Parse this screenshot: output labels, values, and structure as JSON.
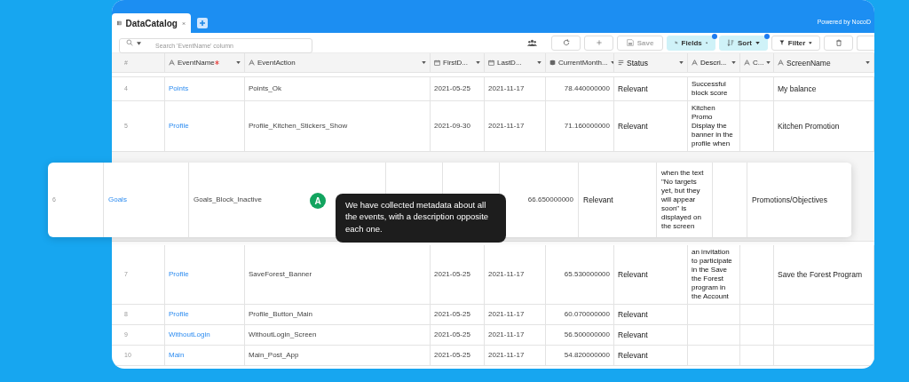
{
  "tab": {
    "title": "DataCatalog"
  },
  "powered_by": "Powered by NocoD",
  "search": {
    "placeholder": "Search 'EventName' column"
  },
  "toolbar": [
    {
      "kind": "reload"
    },
    {
      "kind": "add"
    },
    {
      "kind": "save",
      "label": "Save",
      "disabled": true
    },
    {
      "kind": "fields",
      "label": "Fields",
      "active": true
    },
    {
      "kind": "sort",
      "label": "Sort",
      "active": true
    },
    {
      "kind": "filter",
      "label": "Filter",
      "active": false
    },
    {
      "kind": "delete"
    }
  ],
  "columns": [
    {
      "name": "#",
      "kind": "index",
      "required": false
    },
    {
      "name": "EventName",
      "kind": "text",
      "required": true
    },
    {
      "name": "EventAction",
      "kind": "text",
      "required": false
    },
    {
      "name": "FirstD...",
      "kind": "date",
      "required": false
    },
    {
      "name": "LastD...",
      "kind": "date",
      "required": false
    },
    {
      "name": "CurrentMonth...",
      "kind": "number",
      "required": false
    },
    {
      "name": "Status",
      "kind": "status",
      "required": false
    },
    {
      "name": "Descri...",
      "kind": "text",
      "required": false
    },
    {
      "name": "C...",
      "kind": "text",
      "required": false
    },
    {
      "name": "ScreenName",
      "kind": "text",
      "required": false
    }
  ],
  "rows_above": [
    {
      "number": "4",
      "event_name": "Points",
      "event_action": "Points_Ok",
      "first_date": "2021-05-25",
      "last_date": "2021-11-17",
      "current_month": "78.440000000",
      "status": "Relevant",
      "description": "Successful block score",
      "screen_name": "My balance"
    },
    {
      "number": "5",
      "event_name": "Profile",
      "event_action": "Profile_Kitchen_Stickers_Show",
      "first_date": "2021-09-30",
      "last_date": "2021-11-17",
      "current_month": "71.160000000",
      "status": "Relevant",
      "description": "Kitchen Promo Display the banner in the profile when",
      "screen_name": "Kitchen Promotion"
    }
  ],
  "highlighted_row": {
    "number": "6",
    "event_name": "Goals",
    "event_action": "Goals_Block_Inactive",
    "current_month": "66.650000000",
    "status": "Relevant",
    "description": "when the text \"No targets yet, but they will appear soon\" is displayed on the screen",
    "screen_name": "Promotions/Objectives"
  },
  "rows_below": [
    {
      "number": "7",
      "event_name": "Profile",
      "event_action": "SaveForest_Banner",
      "first_date": "2021-05-25",
      "last_date": "2021-11-17",
      "current_month": "65.530000000",
      "status": "Relevant",
      "description": "an invitation to participate in the Save the Forest program in the Account",
      "screen_name": "Save the Forest Program"
    },
    {
      "number": "8",
      "event_name": "Profile",
      "event_action": "Profile_Button_Main",
      "first_date": "2021-05-25",
      "last_date": "2021-11-17",
      "current_month": "60.070000000",
      "status": "Relevant"
    },
    {
      "number": "9",
      "event_name": "WithoutLogin",
      "event_action": "WithoutLogin_Screen",
      "first_date": "2021-05-25",
      "last_date": "2021-11-17",
      "current_month": "56.500000000",
      "status": "Relevant"
    },
    {
      "number": "10",
      "event_name": "Main",
      "event_action": "Main_Post_App",
      "first_date": "2021-05-25",
      "last_date": "2021-11-17",
      "current_month": "54.820000000",
      "status": "Relevant"
    }
  ],
  "tooltip": {
    "badge": "A",
    "text": "We have collected metadata about all the events, with a description opposite each one."
  }
}
